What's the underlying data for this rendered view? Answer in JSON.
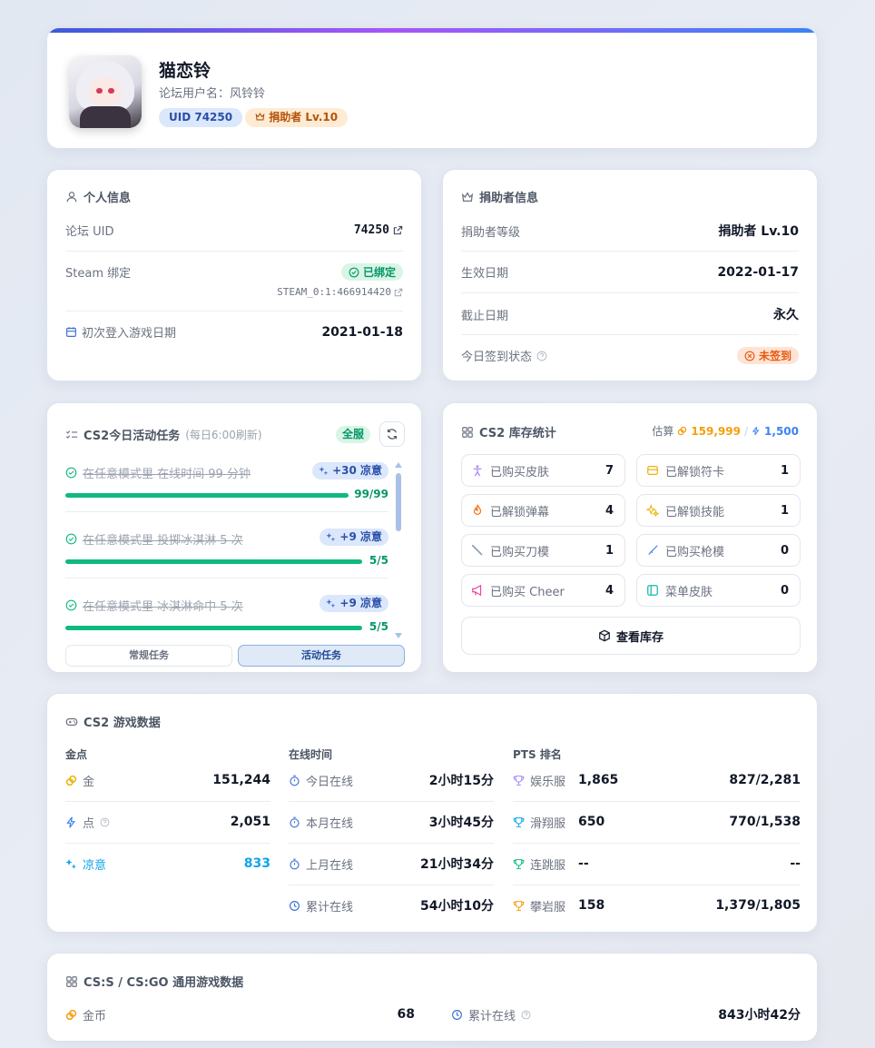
{
  "profile": {
    "name": "猫恋铃",
    "forum_name": "论坛用户名：风铃铃",
    "uid_badge": "UID 74250",
    "donor_badge": "捐助者 Lv.10"
  },
  "personal": {
    "title": "个人信息",
    "uid_label": "论坛 UID",
    "uid_value": "74250",
    "steam_label": "Steam 绑定",
    "steam_status": "已绑定",
    "steam_id": "STEAM_0:1:466914420",
    "first_login_label": "初次登入游戏日期",
    "first_login_value": "2021-01-18"
  },
  "donor": {
    "title": "捐助者信息",
    "level_label": "捐助者等级",
    "level_value": "捐助者 Lv.10",
    "start_label": "生效日期",
    "start_value": "2022-01-17",
    "end_label": "截止日期",
    "end_value": "永久",
    "checkin_label": "今日签到状态",
    "checkin_value": "未签到"
  },
  "tasks": {
    "title": "CS2今日活动任务",
    "subtitle": "(每日6:00刷新)",
    "server": "全服",
    "items": [
      {
        "text": "在任意模式里 在线时间 99 分钟",
        "reward": "+30 凉意",
        "progress": "99/99",
        "fraction": 1.0
      },
      {
        "text": "在任意模式里 投掷冰淇淋 5 次",
        "reward": "+9 凉意",
        "progress": "5/5",
        "fraction": 1.0
      },
      {
        "text": "在任意模式里 冰淇淋命中 5 次",
        "reward": "+9 凉意",
        "progress": "5/5",
        "fraction": 1.0
      }
    ],
    "tab_normal": "常规任务",
    "tab_event": "活动任务"
  },
  "inventory": {
    "title": "CS2 库存统计",
    "est_label": "估算",
    "est_gold": "159,999",
    "est_sep": "/",
    "est_point": "1,500",
    "items": [
      {
        "label": "已购买皮肤",
        "count": "7"
      },
      {
        "label": "已解锁符卡",
        "count": "1"
      },
      {
        "label": "已解锁弹幕",
        "count": "4"
      },
      {
        "label": "已解锁技能",
        "count": "1"
      },
      {
        "label": "已购买刀模",
        "count": "1"
      },
      {
        "label": "已购买枪模",
        "count": "0"
      },
      {
        "label": "已购买 Cheer",
        "count": "4"
      },
      {
        "label": "菜单皮肤",
        "count": "0"
      }
    ],
    "view_button": "查看库存"
  },
  "game": {
    "title": "CS2 游戏数据",
    "col_money": "金点",
    "col_online": "在线时间",
    "col_pts": "PTS 排名",
    "money": [
      {
        "label": "金",
        "value": "151,244"
      },
      {
        "label": "点",
        "value": "2,051"
      },
      {
        "label": "凉意",
        "value": "833"
      }
    ],
    "online": [
      {
        "label": "今日在线",
        "value": "2小时15分"
      },
      {
        "label": "本月在线",
        "value": "3小时45分"
      },
      {
        "label": "上月在线",
        "value": "21小时34分"
      },
      {
        "label": "累计在线",
        "value": "54小时10分"
      }
    ],
    "pts": [
      {
        "label": "娱乐服",
        "score": "1,865",
        "rank": "827/2,281"
      },
      {
        "label": "滑翔服",
        "score": "650",
        "rank": "770/1,538"
      },
      {
        "label": "连跳服",
        "score": "--",
        "rank": "--"
      },
      {
        "label": "攀岩服",
        "score": "158",
        "rank": "1,379/1,805"
      }
    ]
  },
  "csgo": {
    "title": "CS:S / CS:GO 通用游戏数据",
    "coin_label": "金币",
    "coin_value": "68",
    "online_label": "累计在线",
    "online_value": "843小时42分"
  }
}
